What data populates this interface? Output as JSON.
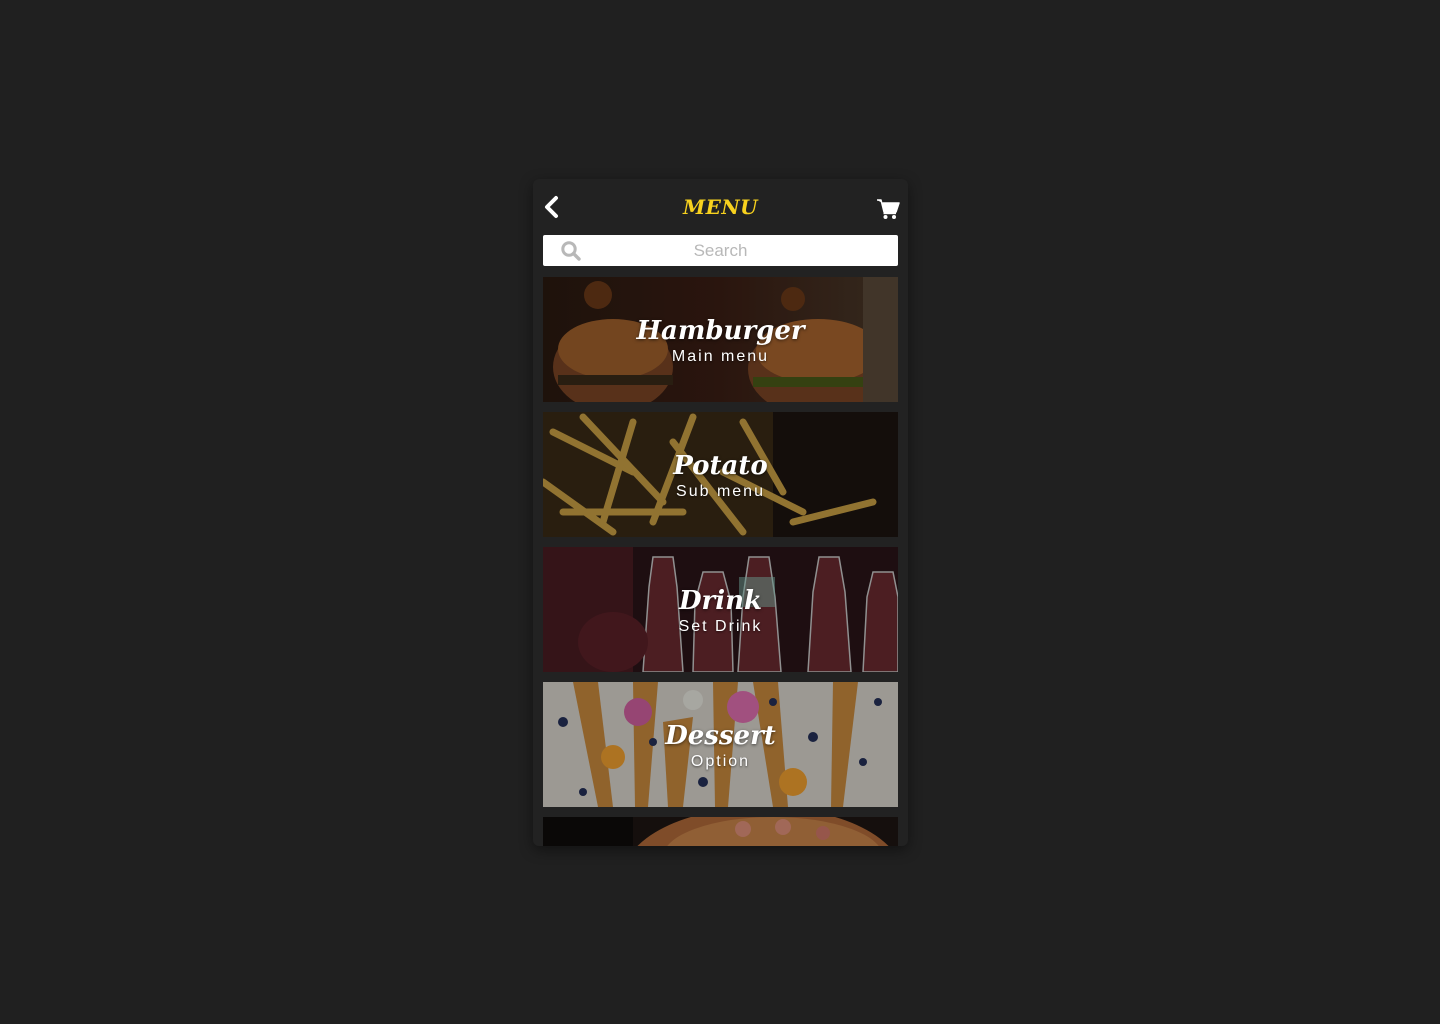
{
  "header": {
    "title": "MENU",
    "back_icon": "chevron-left-icon",
    "cart_icon": "cart-icon",
    "accent_color": "#f7d11e"
  },
  "search": {
    "placeholder": "Search",
    "value": "",
    "icon": "search-icon"
  },
  "categories": [
    {
      "name": "Hamburger",
      "subtitle": "Main menu"
    },
    {
      "name": "Potato",
      "subtitle": "Sub menu"
    },
    {
      "name": "Drink",
      "subtitle": "Set Drink"
    },
    {
      "name": "Dessert",
      "subtitle": "Option"
    },
    {
      "name": "",
      "subtitle": ""
    }
  ],
  "colors": {
    "page_background": "#202020",
    "phone_background": "#222222",
    "search_background": "#ffffff",
    "card_text": "#ffffff"
  }
}
